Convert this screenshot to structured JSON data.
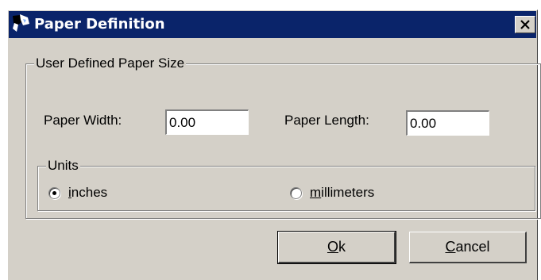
{
  "window": {
    "title": "Paper Definition",
    "close_glyph": "✕",
    "icon": "printer-app-icon"
  },
  "paper_group": {
    "legend": "User Defined Paper Size",
    "width_label": "Paper Width:",
    "width_value": "0.00",
    "length_label": "Paper Length:",
    "length_value": "0.00"
  },
  "units_group": {
    "legend": "Units",
    "options": [
      {
        "mnemonic": "i",
        "rest": "nches",
        "selected": true
      },
      {
        "mnemonic": "m",
        "rest": "illimeters",
        "selected": false
      }
    ]
  },
  "buttons": {
    "ok_mnemonic": "O",
    "ok_rest": "k",
    "cancel_mnemonic": "C",
    "cancel_rest": "ancel"
  },
  "colors": {
    "titlebar": "#0a246a",
    "face": "#d4d0c8"
  }
}
